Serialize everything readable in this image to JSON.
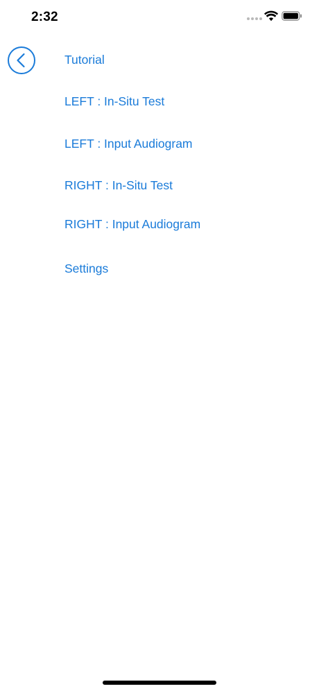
{
  "status_bar": {
    "time": "2:32",
    "icons": [
      "signal-icon",
      "wifi-icon",
      "battery-icon"
    ]
  },
  "nav": {
    "back_icon": "chevron-left-icon"
  },
  "menu": {
    "items": [
      {
        "label": "Tutorial"
      },
      {
        "label": "LEFT : In-Situ Test"
      },
      {
        "label": "LEFT : Input Audiogram"
      },
      {
        "label": "RIGHT : In-Situ Test"
      },
      {
        "label": "RIGHT : Input Audiogram"
      },
      {
        "label": "Settings"
      }
    ]
  },
  "colors": {
    "accent": "#1a7bd9",
    "background": "#ffffff",
    "text": "#000000"
  }
}
